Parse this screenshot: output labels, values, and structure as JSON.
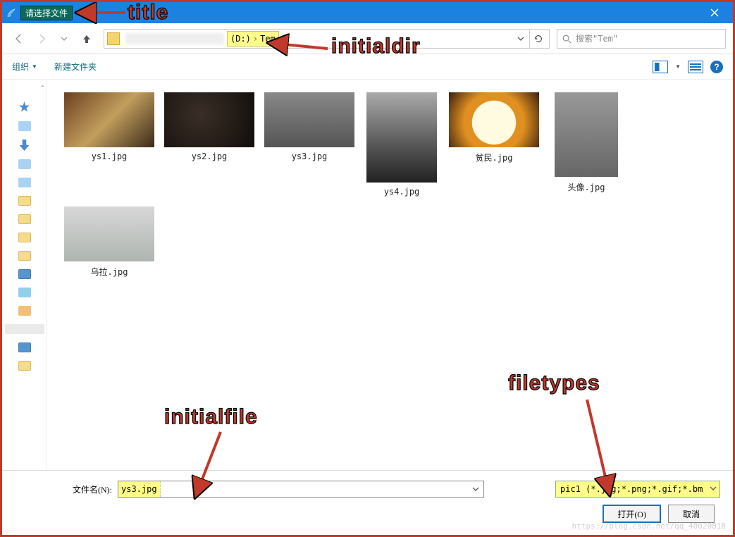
{
  "titlebar": {
    "title": "请选择文件"
  },
  "nav": {
    "path_drive": "(D:)",
    "path_folder": "Tem",
    "search_placeholder": "搜索\"Tem\""
  },
  "toolbar": {
    "organize": "组织",
    "newfolder": "新建文件夹"
  },
  "files": [
    {
      "name": "ys1.jpg"
    },
    {
      "name": "ys2.jpg"
    },
    {
      "name": "ys3.jpg"
    },
    {
      "name": "ys4.jpg"
    },
    {
      "name": "贫民.jpg"
    },
    {
      "name": "头像.jpg"
    },
    {
      "name": "乌拉.jpg"
    }
  ],
  "bottom": {
    "filename_label": "文件名(N):",
    "filename_value": "ys3.jpg",
    "filetypes": "pic1 (*.jpg;*.png;*.gif;*.bm",
    "open": "打开(O)",
    "cancel": "取消"
  },
  "annotations": {
    "title": "title",
    "initialdir": "initialdir",
    "initialfile": "initialfile",
    "filetypes": "filetypes"
  },
  "watermark": "https://blog.csdn.net/qq_40020818"
}
